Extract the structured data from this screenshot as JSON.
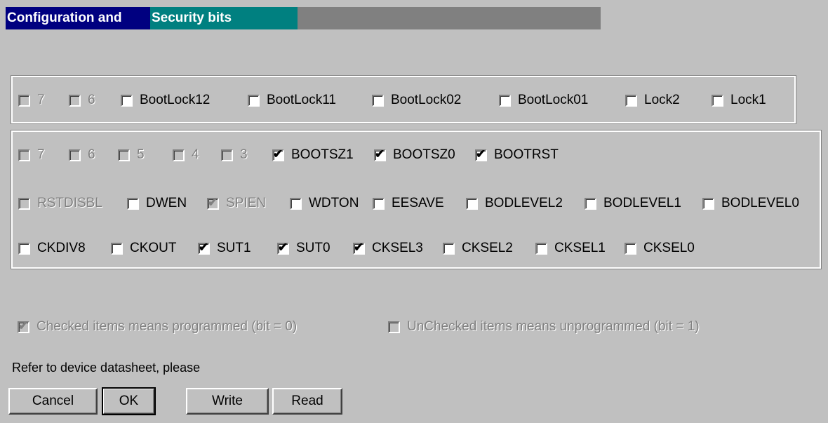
{
  "window": {
    "title_part1": "Configuration and",
    "title_part2": "Security bits"
  },
  "lock_bits": [
    {
      "label": "7",
      "checked": false,
      "enabled": false
    },
    {
      "label": "6",
      "checked": false,
      "enabled": false
    },
    {
      "label": "BootLock12",
      "checked": false,
      "enabled": true
    },
    {
      "label": "BootLock11",
      "checked": false,
      "enabled": true
    },
    {
      "label": "BootLock02",
      "checked": false,
      "enabled": true
    },
    {
      "label": "BootLock01",
      "checked": false,
      "enabled": true
    },
    {
      "label": "Lock2",
      "checked": false,
      "enabled": true
    },
    {
      "label": "Lock1",
      "checked": false,
      "enabled": true
    }
  ],
  "fuse_extended": [
    {
      "label": "7",
      "checked": false,
      "enabled": false
    },
    {
      "label": "6",
      "checked": false,
      "enabled": false
    },
    {
      "label": "5",
      "checked": false,
      "enabled": false
    },
    {
      "label": "4",
      "checked": false,
      "enabled": false
    },
    {
      "label": "3",
      "checked": false,
      "enabled": false
    },
    {
      "label": "BOOTSZ1",
      "checked": true,
      "enabled": true
    },
    {
      "label": "BOOTSZ0",
      "checked": true,
      "enabled": true
    },
    {
      "label": "BOOTRST",
      "checked": true,
      "enabled": true
    }
  ],
  "fuse_high": [
    {
      "label": "RSTDISBL",
      "checked": false,
      "enabled": false
    },
    {
      "label": "DWEN",
      "checked": false,
      "enabled": true
    },
    {
      "label": "SPIEN",
      "checked": true,
      "enabled": false
    },
    {
      "label": "WDTON",
      "checked": false,
      "enabled": true
    },
    {
      "label": "EESAVE",
      "checked": false,
      "enabled": true
    },
    {
      "label": "BODLEVEL2",
      "checked": false,
      "enabled": true
    },
    {
      "label": "BODLEVEL1",
      "checked": false,
      "enabled": true
    },
    {
      "label": "BODLEVEL0",
      "checked": false,
      "enabled": true
    }
  ],
  "fuse_low": [
    {
      "label": "CKDIV8",
      "checked": false,
      "enabled": true
    },
    {
      "label": "CKOUT",
      "checked": false,
      "enabled": true
    },
    {
      "label": "SUT1",
      "checked": true,
      "enabled": true
    },
    {
      "label": "SUT0",
      "checked": true,
      "enabled": true
    },
    {
      "label": "CKSEL3",
      "checked": true,
      "enabled": true
    },
    {
      "label": "CKSEL2",
      "checked": false,
      "enabled": true
    },
    {
      "label": "CKSEL1",
      "checked": false,
      "enabled": true
    },
    {
      "label": "CKSEL0",
      "checked": false,
      "enabled": true
    }
  ],
  "legend": {
    "checked_label": "Checked items means programmed (bit = 0)",
    "checked_state": true,
    "unchecked_label": "UnChecked items means unprogrammed (bit = 1)",
    "unchecked_state": false
  },
  "note": "Refer to device datasheet, please",
  "buttons": {
    "cancel": "Cancel",
    "ok": "OK",
    "write": "Write",
    "read": "Read"
  },
  "colors": {
    "title_active": "#000080",
    "title_accent": "#008080",
    "face": "#c0c0c0"
  }
}
